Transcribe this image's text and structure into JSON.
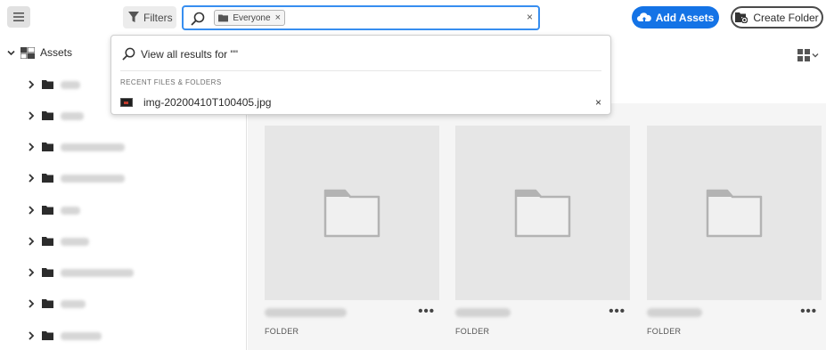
{
  "toolbar": {
    "menu_icon": "hamburger-icon",
    "filters_label": "Filters",
    "filter_icon": "funnel-icon",
    "search": {
      "scope_tag": "Everyone",
      "value": "",
      "placeholder": "",
      "clear_label": "×"
    },
    "add_assets_label": "Add Assets",
    "create_folder_label": "Create Folder",
    "accent_color": "#1473e6"
  },
  "search_dropdown": {
    "view_all_label": "View all results for \"\"",
    "recent_heading": "RECENT FILES & FOLDERS",
    "recent_items": [
      {
        "name": "img-20200410T100405.jpg",
        "remove_label": "×"
      }
    ]
  },
  "sidebar": {
    "root_label": "Assets",
    "items_count_shown": 9
  },
  "content": {
    "view_icon": "grid-view-icon",
    "cards": [
      {
        "type_label": "FOLDER",
        "more_label": "•••"
      },
      {
        "type_label": "FOLDER",
        "more_label": "•••"
      },
      {
        "type_label": "FOLDER",
        "more_label": "•••"
      }
    ]
  }
}
